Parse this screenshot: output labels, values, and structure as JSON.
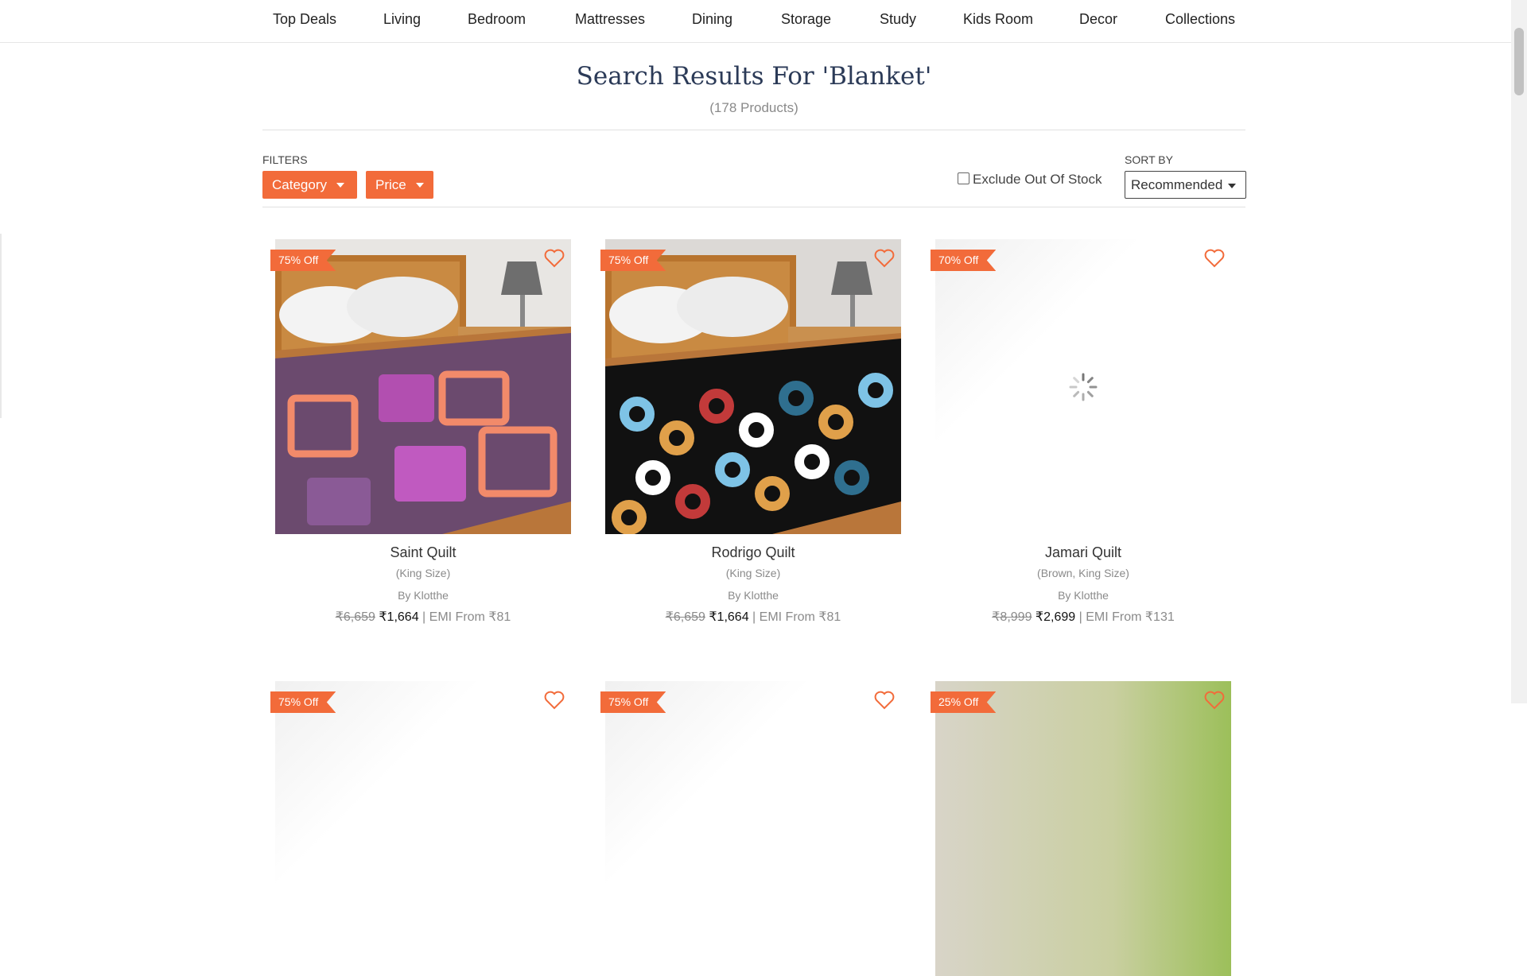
{
  "nav": {
    "items": [
      "Top Deals",
      "Living",
      "Bedroom",
      "Mattresses",
      "Dining",
      "Storage",
      "Study",
      "Kids Room",
      "Decor",
      "Collections"
    ]
  },
  "search": {
    "title": "Search Results For 'Blanket'",
    "count": "(178 Products)"
  },
  "filters": {
    "label": "FILTERS",
    "category": "Category",
    "price": "Price",
    "exclude_out_of_stock": "Exclude Out Of Stock"
  },
  "sort": {
    "label": "SORT BY",
    "selected": "Recommended"
  },
  "products": [
    {
      "badge": "75% Off",
      "name": "Saint Quilt",
      "size": "(King Size)",
      "by": "By Klotthe",
      "mrp": "₹6,659",
      "price": "₹1,664",
      "emi": "| EMI From ₹81"
    },
    {
      "badge": "75% Off",
      "name": "Rodrigo Quilt",
      "size": "(King Size)",
      "by": "By Klotthe",
      "mrp": "₹6,659",
      "price": "₹1,664",
      "emi": "| EMI From ₹81"
    },
    {
      "badge": "70% Off",
      "name": "Jamari Quilt",
      "size": "(Brown, King Size)",
      "by": "By Klotthe",
      "mrp": "₹8,999",
      "price": "₹2,699",
      "emi": "| EMI From ₹131"
    },
    {
      "badge": "75% Off"
    },
    {
      "badge": "75% Off"
    },
    {
      "badge": "25% Off"
    }
  ],
  "colors": {
    "accent": "#f26b3a",
    "title": "#2b3a57"
  }
}
